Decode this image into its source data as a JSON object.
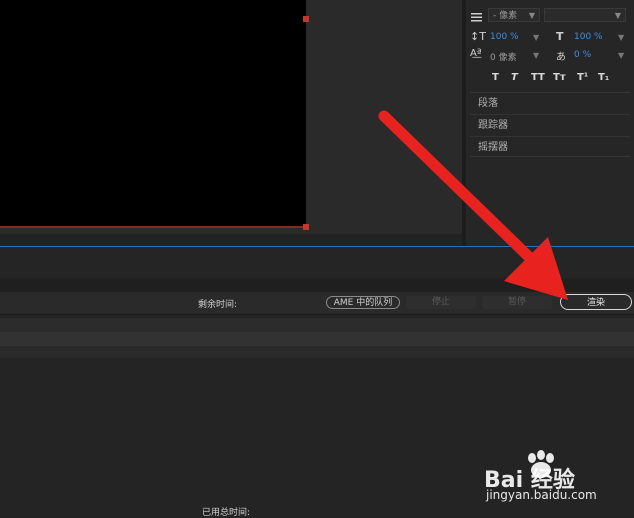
{
  "character_panel": {
    "font_size_unit": "- 像素",
    "leading_value": "100 %",
    "tracking_value": "100 %",
    "baseline_value": "0 像素",
    "tsume_value": "0 %",
    "style_buttons": [
      "T",
      "T",
      "TT",
      "Tт",
      "T¹",
      "T₁"
    ],
    "sections": [
      "段落",
      "跟踪器",
      "摇摆器"
    ]
  },
  "render_queue": {
    "remaining_label": "剩余时间:",
    "ame_button": "AME 中的队列",
    "stop_button": "停止",
    "pause_button": "暂停",
    "render_button": "渲染",
    "elapsed_label": "已用总时间:"
  },
  "watermark": {
    "logo": "Bai 经验",
    "url": "jingyan.baidu.com"
  },
  "colors": {
    "canvas": "#000000",
    "handle": "#c0392b",
    "accent_blue": "#3c8fe0",
    "annotation_arrow": "#e8231f"
  },
  "icons": [
    "menu-icon",
    "leading-icon",
    "tracking-icon",
    "baseline-shift-icon",
    "tsume-icon",
    "paw-icon"
  ]
}
